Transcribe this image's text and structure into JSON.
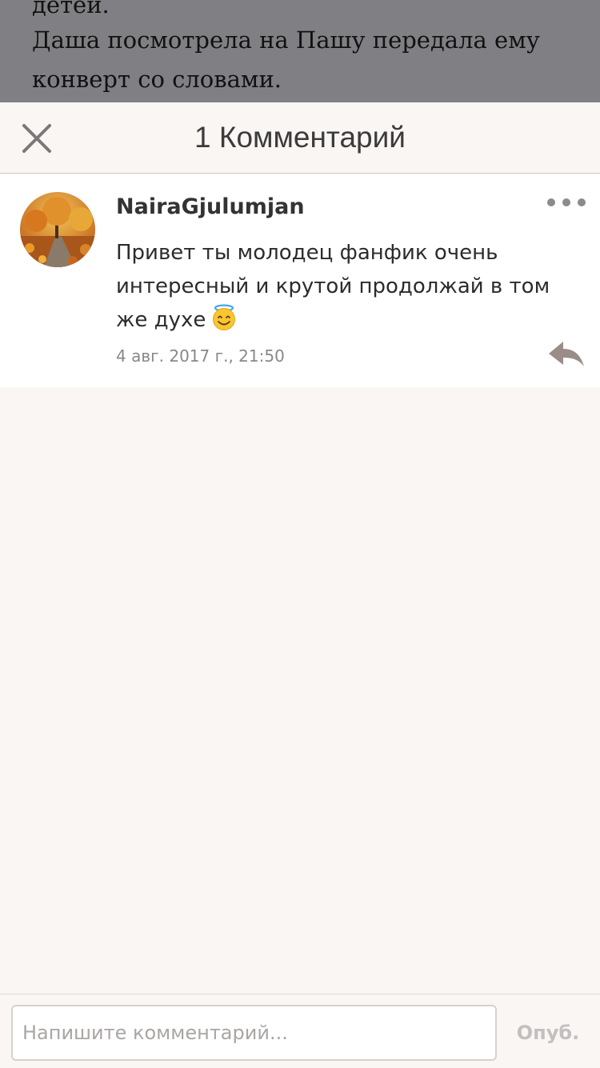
{
  "story": {
    "lines": [
      "детей.",
      "Даша посмотрела на Пашу передала ему",
      "конверт со словами."
    ]
  },
  "header": {
    "title": "1 Комментарий",
    "close_icon": "close-icon"
  },
  "comment": {
    "username": "NairaGjulumjan",
    "text": "Привет ты молодец фанфик очень интересный и крутой продолжай в том же духе",
    "emoji": "smiling-face-with-halo",
    "timestamp": "4 авг. 2017 г., 21:50",
    "more_icon": "more-dots-icon",
    "reply_icon": "reply-arrow-icon"
  },
  "footer": {
    "input_placeholder": "Напишите комментарий...",
    "input_value": "",
    "publish_label": "Опуб."
  },
  "colors": {
    "background": "#f9f6f3",
    "dim_overlay": "#807f83",
    "card": "#ffffff",
    "icon_grey": "#8e8a88",
    "reply_brown": "#9a8d87",
    "publish_disabled": "#c2c0bf"
  }
}
